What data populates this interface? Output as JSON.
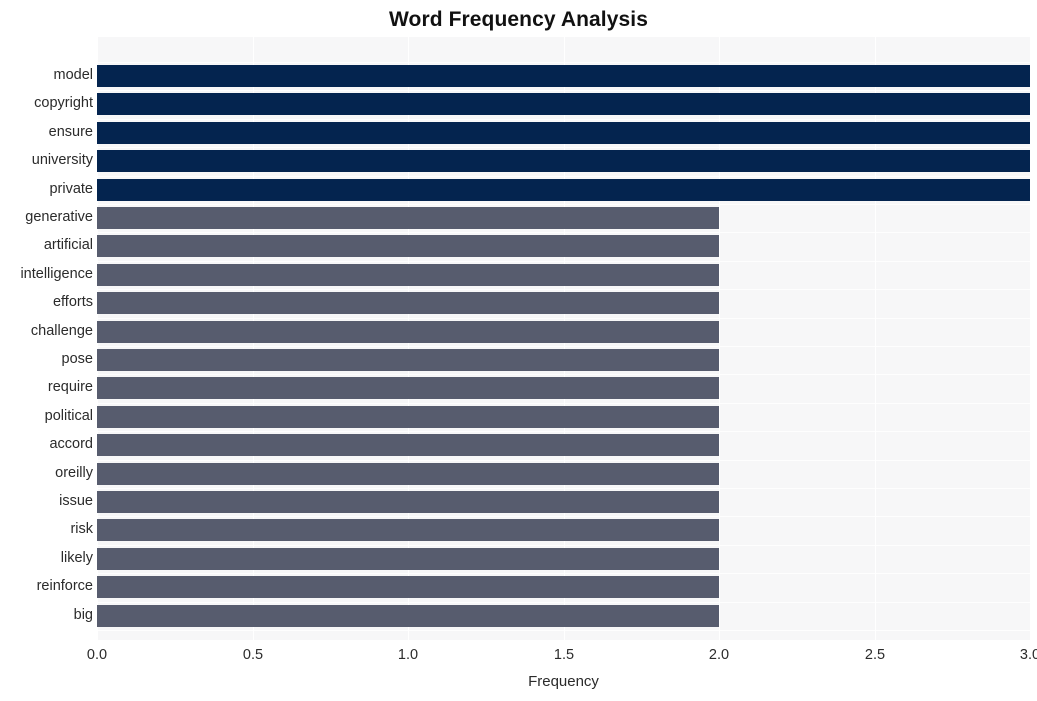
{
  "chart_data": {
    "type": "bar",
    "orientation": "horizontal",
    "title": "Word Frequency Analysis",
    "xlabel": "Frequency",
    "ylabel": "",
    "xlim": [
      0.0,
      3.0
    ],
    "xticks": [
      "0.0",
      "0.5",
      "1.0",
      "1.5",
      "2.0",
      "2.5",
      "3.0"
    ],
    "xtick_values": [
      0.0,
      0.5,
      1.0,
      1.5,
      2.0,
      2.5,
      3.0
    ],
    "grid": true,
    "legend": false,
    "categories": [
      "model",
      "copyright",
      "ensure",
      "university",
      "private",
      "generative",
      "artificial",
      "intelligence",
      "efforts",
      "challenge",
      "pose",
      "require",
      "political",
      "accord",
      "oreilly",
      "issue",
      "risk",
      "likely",
      "reinforce",
      "big"
    ],
    "values": [
      3,
      3,
      3,
      3,
      3,
      2,
      2,
      2,
      2,
      2,
      2,
      2,
      2,
      2,
      2,
      2,
      2,
      2,
      2,
      2
    ],
    "bar_colors": [
      "#04244f",
      "#04244f",
      "#04244f",
      "#04244f",
      "#04244f",
      "#575c6e",
      "#575c6e",
      "#575c6e",
      "#575c6e",
      "#575c6e",
      "#575c6e",
      "#575c6e",
      "#575c6e",
      "#575c6e",
      "#575c6e",
      "#575c6e",
      "#575c6e",
      "#575c6e",
      "#575c6e",
      "#575c6e"
    ]
  },
  "colors": {
    "plot_background": "#f7f7f8",
    "figure_background": "#ffffff",
    "gridline": "#ffffff",
    "high_value_bar": "#04244f",
    "low_value_bar": "#575c6e",
    "text": "#2b2b2b",
    "title_text": "#111111"
  }
}
